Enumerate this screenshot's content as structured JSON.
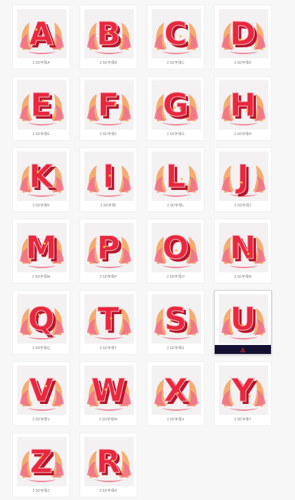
{
  "colors": {
    "accent_red": "#e8283f",
    "stripe_light": "#f9c2c9",
    "leaf_orange": "#f5a05a",
    "leaf_pink": "#f07088",
    "download_bar": "#141032",
    "download_icon": "#e8283f"
  },
  "items": [
    {
      "letter": "A",
      "label": "2.5D字母A"
    },
    {
      "letter": "B",
      "label": "2.5D字母B"
    },
    {
      "letter": "C",
      "label": "2.5D字母C"
    },
    {
      "letter": "D",
      "label": "2.5D字母D"
    },
    {
      "letter": "E",
      "label": "2.5D字母E"
    },
    {
      "letter": "F",
      "label": "2.5D字母F"
    },
    {
      "letter": "G",
      "label": "2.5D字母G"
    },
    {
      "letter": "H",
      "label": "2.5D字母H"
    },
    {
      "letter": "K",
      "label": "2.5D字母K"
    },
    {
      "letter": "I",
      "label": "2.5D字母I"
    },
    {
      "letter": "L",
      "label": "2.5D字母L"
    },
    {
      "letter": "J",
      "label": "2.5D字母J"
    },
    {
      "letter": "M",
      "label": "2.5D字母M"
    },
    {
      "letter": "P",
      "label": "2.5D字母P"
    },
    {
      "letter": "O",
      "label": "2.5D字母O"
    },
    {
      "letter": "N",
      "label": "2.5D字母N"
    },
    {
      "letter": "Q",
      "label": "2.5D字母Q"
    },
    {
      "letter": "T",
      "label": "2.5D字母T"
    },
    {
      "letter": "S",
      "label": "2.5D字母S"
    },
    {
      "letter": "U",
      "label": "2.5D字母U",
      "hovered": true,
      "download_icon": "download-icon"
    },
    {
      "letter": "V",
      "label": "2.5D字母V"
    },
    {
      "letter": "W",
      "label": "2.5D字母W"
    },
    {
      "letter": "X",
      "label": "2.5D字母X"
    },
    {
      "letter": "Y",
      "label": "2.5D字母Y"
    },
    {
      "letter": "Z",
      "label": "2.5D字母Z"
    },
    {
      "letter": "R",
      "label": "2.5D字母R"
    }
  ]
}
